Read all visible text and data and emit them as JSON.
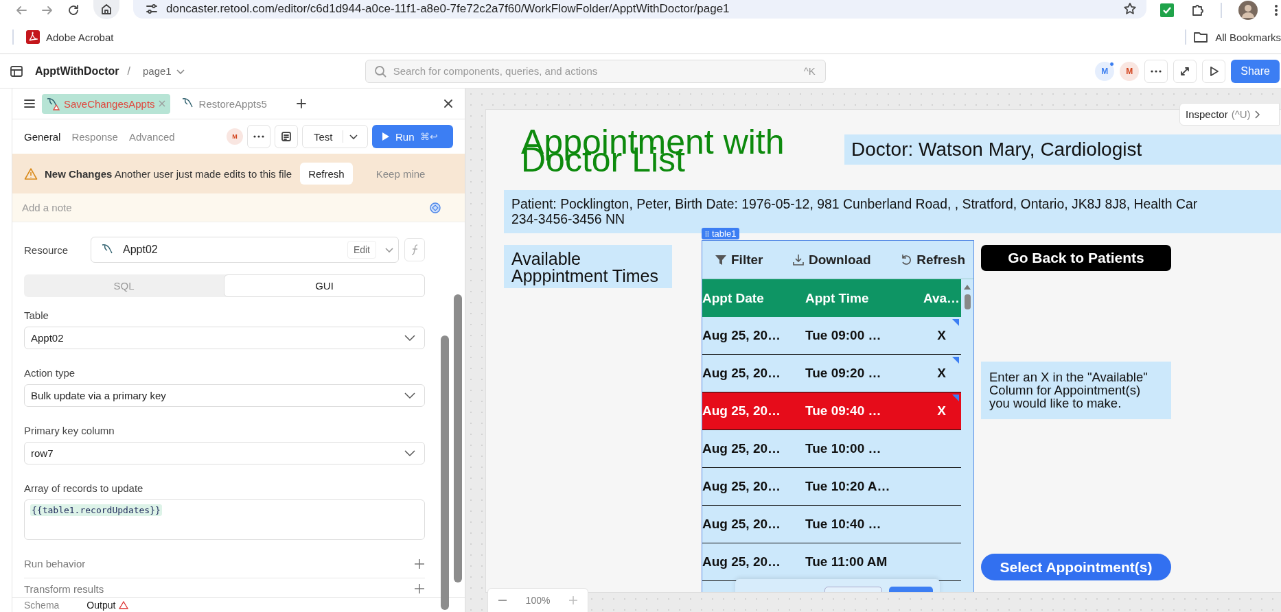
{
  "browser": {
    "url": "doncaster.retool.com/editor/c6d1d944-a0ce-11f1-a8e0-7fe72c2a7f60/WorkFlowFolder/ApptWithDoctor/page1",
    "bookmarks": [
      {
        "label": "Adobe Acrobat"
      }
    ],
    "all_bookmarks": "All Bookmarks"
  },
  "app_header": {
    "app_name": "ApptWithDoctor",
    "separator": "/",
    "page": "page1",
    "search": {
      "placeholder": "Search for components, queries, and actions",
      "shortcut": "^K"
    },
    "avatars": [
      {
        "initial": "M",
        "color": "#3b7ef0",
        "online": true
      },
      {
        "initial": "M",
        "color": "#d2431c",
        "online": false
      }
    ],
    "share": "Share"
  },
  "query_panel": {
    "tabs": [
      {
        "label": "SaveChangesAppts",
        "selected": true,
        "warning": true
      },
      {
        "label": "RestoreAppts5",
        "selected": false,
        "warning": false
      }
    ],
    "subtabs": [
      {
        "label": "General",
        "selected": true
      },
      {
        "label": "Response",
        "selected": false
      },
      {
        "label": "Advanced",
        "selected": false
      }
    ],
    "avatar": {
      "initial": "M",
      "color": "#d2431c"
    },
    "test": "Test",
    "run": "Run",
    "run_shortcut": "⌘↩",
    "banner": {
      "title": "New Changes",
      "message": "Another user just made edits to this file",
      "refresh": "Refresh",
      "keep": "Keep mine"
    },
    "note_placeholder": "Add a note",
    "resource": {
      "label": "Resource",
      "value": "Appt02",
      "edit": "Edit"
    },
    "mode_toggle": [
      {
        "label": "SQL",
        "selected": false
      },
      {
        "label": "GUI",
        "selected": true
      }
    ],
    "fields": [
      {
        "label": "Table",
        "value": "Appt02",
        "kind": "select"
      },
      {
        "label": "Action type",
        "value": "Bulk update via a primary key",
        "kind": "select"
      },
      {
        "label": "Primary key column",
        "value": "row7",
        "kind": "select"
      },
      {
        "label": "Array of records to update",
        "value": "{{table1.recordUpdates}}",
        "kind": "code"
      }
    ],
    "sections": [
      "Run behavior",
      "Transform results"
    ],
    "bottom_tabs": [
      {
        "label": "Schema",
        "warning": false
      },
      {
        "label": "Output",
        "warning": true
      }
    ]
  },
  "canvas": {
    "inspector": {
      "label": "Inspector",
      "shortcut": "(^U)"
    },
    "app": {
      "title": "Appointment with Doctor List",
      "doctor": "Doctor: Watson Mary, Cardiologist",
      "patient_lines": [
        "Patient: Pocklington, Peter, Birth Date: 1976-05-12, 981 Cunberland Road, , Stratford, Ontario, JK8J 8J8, Health Car",
        "234-3456-3456 NN"
      ],
      "available_label": "Available Apppintment Times",
      "table": {
        "name": "table1",
        "toolbar": [
          "Filter",
          "Download",
          "Refresh"
        ],
        "columns": [
          "Appt Date",
          "Appt Time",
          "Ava…"
        ],
        "rows": [
          {
            "date": "Aug 25, 20…",
            "time": "Tue 09:00 …",
            "available": "X",
            "changed": true,
            "highlighted": false
          },
          {
            "date": "Aug 25, 20…",
            "time": "Tue 09:20 …",
            "available": "X",
            "changed": true,
            "highlighted": false
          },
          {
            "date": "Aug 25, 20…",
            "time": "Tue 09:40 …",
            "available": "X",
            "changed": true,
            "highlighted": true
          },
          {
            "date": "Aug 25, 20…",
            "time": "Tue 10:00 …",
            "changed": false,
            "highlighted": false
          },
          {
            "date": "Aug 25, 20…",
            "time": "Tue 10:20 A…",
            "changed": false,
            "highlighted": false
          },
          {
            "date": "Aug 25, 20…",
            "time": "Tue 10:40 …",
            "changed": false,
            "highlighted": false
          },
          {
            "date": "Aug 25, 20…",
            "time": "Tue 11:00 AM",
            "changed": false,
            "highlighted": false
          }
        ]
      },
      "go_back": "Go Back to Patients",
      "help": "Enter an X in the \"Available\" Column for Appointment(s) you would like to make.",
      "select": "Select Appointment(s)"
    },
    "zoom": {
      "level_text": "100%"
    }
  }
}
